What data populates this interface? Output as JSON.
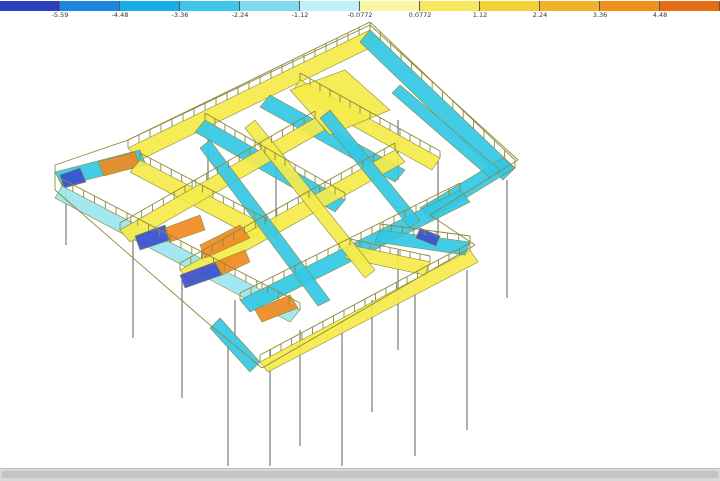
{
  "legend": {
    "ticks": [
      "-5.59",
      "-4.48",
      "-3.36",
      "-2.24",
      "-1.12",
      "-0.0772",
      "0.0772",
      "1.12",
      "2.24",
      "3.36",
      "4.48"
    ],
    "colors": [
      "#2b3fbf",
      "#1f86e0",
      "#17aee8",
      "#3cc6ec",
      "#7fdcf0",
      "#bff0f5",
      "#fbf6a0",
      "#f7e75a",
      "#f5cf36",
      "#f3b02a",
      "#ef8f1c",
      "#e86c14"
    ]
  },
  "model": {
    "beam_frame_color": "#8a8a3a",
    "column_color": "#7a7a7a",
    "stress_colors": {
      "low": "#3a4fd0",
      "cyan": "#33c8e6",
      "light": "#9be6f0",
      "yellow": "#f4ea4a",
      "orange": "#f08a22"
    }
  }
}
